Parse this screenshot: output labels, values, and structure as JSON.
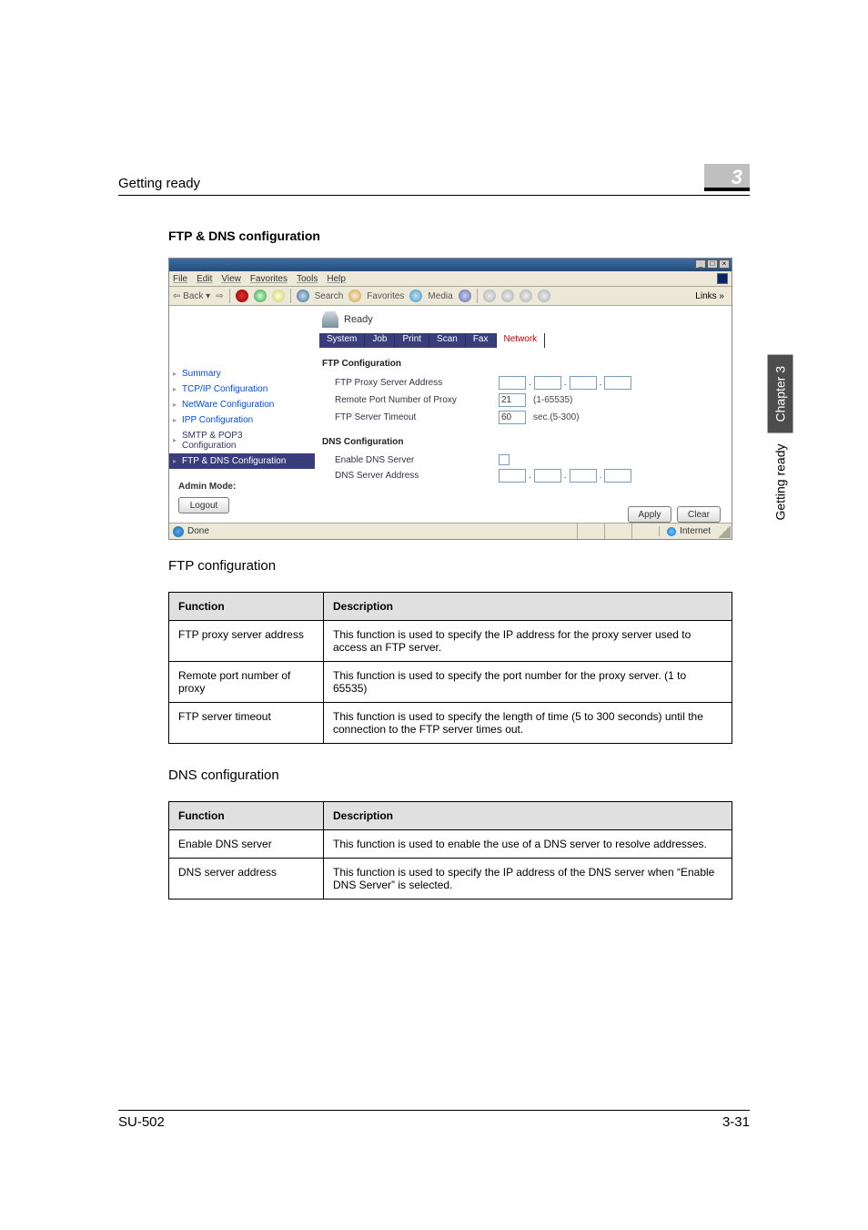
{
  "header": {
    "left": "Getting ready",
    "right": "3"
  },
  "section_title": "FTP & DNS configuration",
  "screenshot": {
    "menubar": [
      "File",
      "Edit",
      "View",
      "Favorites",
      "Tools",
      "Help"
    ],
    "toolbar": {
      "back": "Back",
      "search": "Search",
      "favorites": "Favorites",
      "media": "Media",
      "links": "Links"
    },
    "status_ready": "Ready",
    "tabs": [
      "System",
      "Job",
      "Print",
      "Scan",
      "Fax",
      "Network"
    ],
    "nav": {
      "summary": "Summary",
      "tcpip": "TCP/IP Configuration",
      "netware": "NetWare Configuration",
      "ipp": "IPP Configuration",
      "smtppop3_l1": "SMTP & POP3",
      "smtppop3_l2": "Configuration",
      "ftpdns": "FTP & DNS Configuration"
    },
    "admin_mode": "Admin Mode:",
    "logout": "Logout",
    "main": {
      "ftp_title": "FTP Configuration",
      "ftp_proxy_label": "FTP Proxy Server Address",
      "remote_port_label": "Remote Port Number of Proxy",
      "remote_port_value": "21",
      "remote_port_hint": "(1-65535)",
      "server_timeout_label": "FTP Server Timeout",
      "server_timeout_value": "60",
      "server_timeout_hint": "sec.(5-300)",
      "dns_title": "DNS Configuration",
      "enable_dns_label": "Enable DNS Server",
      "dns_addr_label": "DNS Server Address",
      "apply": "Apply",
      "clear": "Clear"
    },
    "statusbar": {
      "done": "Done",
      "internet": "Internet"
    }
  },
  "ftp_caption": "FTP configuration",
  "dns_caption": "DNS configuration",
  "table_headers": {
    "function": "Function",
    "description": "Description"
  },
  "ftp_table": [
    {
      "func": "FTP proxy server address",
      "desc": "This function is used to specify the IP address for the proxy server used to access an FTP server."
    },
    {
      "func": "Remote port number of proxy",
      "desc": "This function is used to specify the port number for the proxy server. (1 to 65535)"
    },
    {
      "func": "FTP server timeout",
      "desc": "This function is used to specify the length of time (5 to 300 seconds) until the connection to the FTP server times out."
    }
  ],
  "dns_table": [
    {
      "func": "Enable DNS server",
      "desc": "This function is used to enable the use of a DNS server to resolve addresses."
    },
    {
      "func": "DNS server address",
      "desc": "This function is used to specify the IP address of the DNS server when “Enable DNS Server” is selected."
    }
  ],
  "side_tab": {
    "light": "Getting ready",
    "dark": "Chapter 3"
  },
  "footer": {
    "left": "SU-502",
    "right": "3-31"
  }
}
